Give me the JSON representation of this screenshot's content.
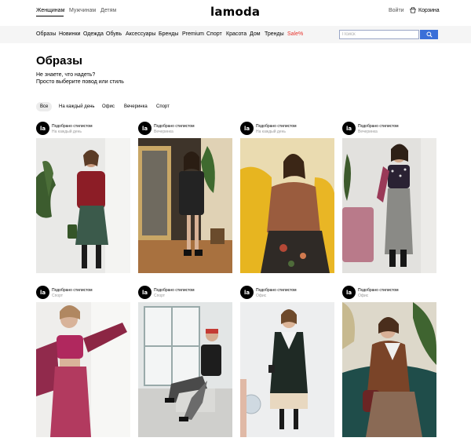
{
  "header": {
    "genders": [
      "Женщинам",
      "Мужчинам",
      "Детям"
    ],
    "logo": "lamoda",
    "login": "Войти",
    "cart": "Корзина"
  },
  "nav": {
    "items": [
      "Образы",
      "Новинки",
      "Одежда",
      "Обувь",
      "Аксессуары",
      "Бренды",
      "Premium",
      "Спорт",
      "Красота",
      "Дом",
      "Тренды"
    ],
    "sale": "Sale%",
    "sale_color": "#e8322b"
  },
  "search": {
    "placeholder": "Поиск",
    "button_color": "#3a6fd8"
  },
  "page": {
    "title": "Образы",
    "subtitle_1": "Не знаете, что надеть?",
    "subtitle_2": "Просто выберите повод или стиль"
  },
  "filters": [
    "Все",
    "На каждый день",
    "Офис",
    "Вечеринка",
    "Спорт"
  ],
  "looks": [
    {
      "badge": "la",
      "by": "Подобрано стилистом",
      "category": "На каждый день",
      "icon": "woman-red-coat-photo"
    },
    {
      "badge": "la",
      "by": "Подобрано стилистом",
      "category": "Вечеринка",
      "icon": "woman-sequin-dress-photo"
    },
    {
      "badge": "la",
      "by": "Подобрано стилистом",
      "category": "На каждый день",
      "icon": "woman-brown-cardigan-photo"
    },
    {
      "badge": "la",
      "by": "Подобрано стилистом",
      "category": "Вечеринка",
      "icon": "woman-polka-dot-top-photo"
    },
    {
      "badge": "la",
      "by": "Подобрано стилистом",
      "category": "Спорт",
      "icon": "woman-pink-sportswear-photo"
    },
    {
      "badge": "la",
      "by": "Подобрано стилистом",
      "category": "Спорт",
      "icon": "woman-houndstooth-leggings-photo"
    },
    {
      "badge": "la",
      "by": "Подобрано стилистом",
      "category": "Офис",
      "icon": "woman-black-sweater-dress-photo"
    },
    {
      "badge": "la",
      "by": "Подобрано стилистом",
      "category": "Офис",
      "icon": "woman-brown-suit-photo"
    }
  ]
}
